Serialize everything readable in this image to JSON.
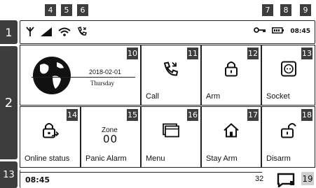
{
  "callouts": {
    "top": [
      "4",
      "5",
      "6",
      "7",
      "8",
      "9"
    ],
    "side": [
      "1",
      "2",
      "13"
    ],
    "tiles": [
      "10",
      "11",
      "12",
      "13",
      "14",
      "15",
      "16",
      "17",
      "18"
    ],
    "bottom_right": "19"
  },
  "status_bar": {
    "icons": [
      "antenna-icon",
      "signal-bars-icon",
      "wifi-icon",
      "phone-icon",
      "key-icon",
      "battery-icon"
    ],
    "time": "08:45"
  },
  "home_tile": {
    "date": "2018-02-01",
    "weekday": "Thursday",
    "icon": "globe-icon"
  },
  "tiles": [
    {
      "label": "Call",
      "icon": "phone-call-icon"
    },
    {
      "label": "Arm",
      "icon": "lock-closed-icon"
    },
    {
      "label": "Socket",
      "icon": "socket-icon"
    },
    {
      "label": "Online status",
      "icon": "lock-status-icon"
    },
    {
      "label": "Panic Alarm",
      "icon": "zone-display",
      "zone_title": "Zone",
      "zone_value": "00"
    },
    {
      "label": "Menu",
      "icon": "menu-window-icon"
    },
    {
      "label": "Stay Arm",
      "icon": "home-icon"
    },
    {
      "label": "Disarm",
      "icon": "lock-open-icon"
    }
  ],
  "bottom_bar": {
    "time": "08:45",
    "count": "32",
    "icon": "message-box-icon"
  }
}
